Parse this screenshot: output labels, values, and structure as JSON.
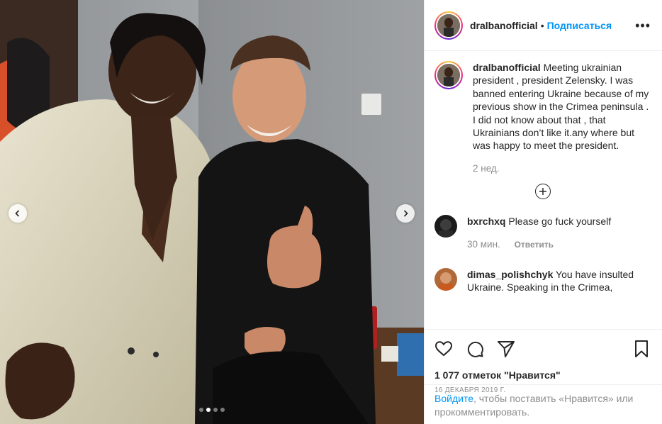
{
  "post": {
    "username": "dralbanofficial",
    "separator": "•",
    "follow_label": "Подписаться",
    "more_label": "•••",
    "caption": "Meeting ukrainian president , president Zelensky. I was banned entering Ukraine because of my previous show in the Crimea peninsula . I did not know about that , that Ukrainians don’t like it.any where but was happy to meet the president.",
    "caption_time": "2 нед.",
    "load_more_icon": "plus-circle-icon",
    "carousel": {
      "total_slides": 4,
      "active_slide": 2
    }
  },
  "comments": [
    {
      "username": "bxrchxq",
      "text": "Please go fuck yourself",
      "time": "30 мин.",
      "reply_label": "Ответить"
    },
    {
      "username": "dimas_polishchyk",
      "text": "You have insulted Ukraine. Speaking in the Crimea,",
      "time": "",
      "reply_label": ""
    }
  ],
  "actions": {
    "like_icon": "heart-icon",
    "comment_icon": "comment-icon",
    "share_icon": "send-icon",
    "save_icon": "bookmark-icon",
    "likes_text": "1 077 отметок \"Нравится\"",
    "date_text": "16 декабря 2019 г."
  },
  "login": {
    "link_text": "Войдите",
    "rest_text": ", чтобы поставить «Нравится» или прокомментировать."
  },
  "colors": {
    "accent_blue": "#0095f6",
    "text": "#262626",
    "muted": "#8e8e8e",
    "border": "#efefef"
  }
}
